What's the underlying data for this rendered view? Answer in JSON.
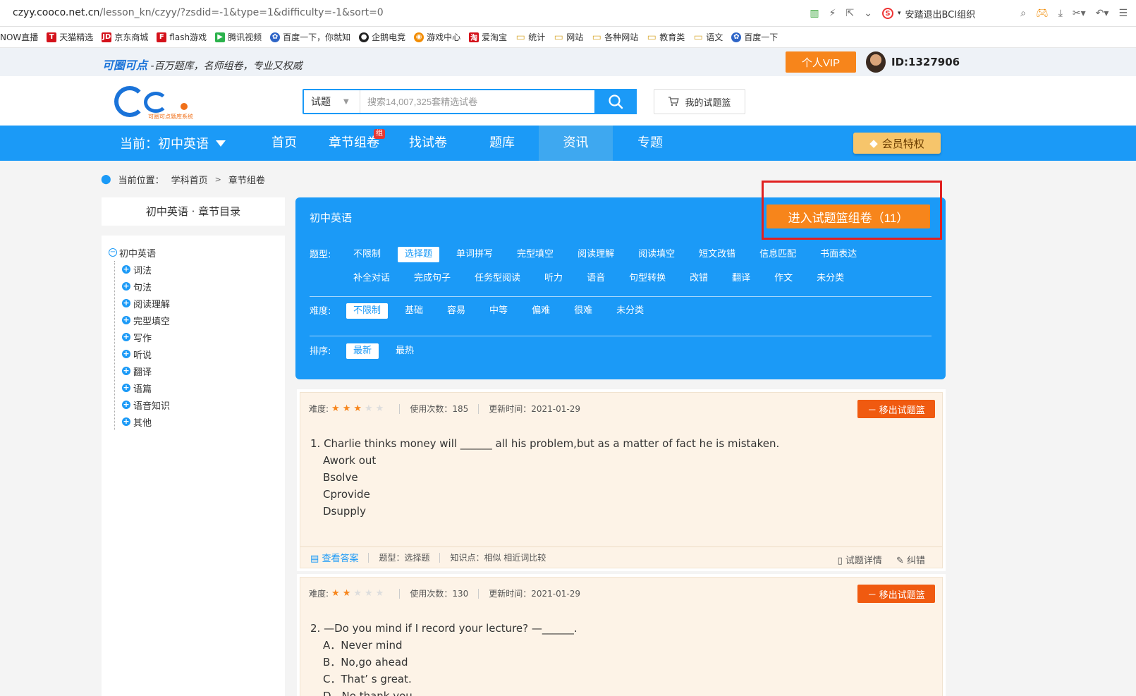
{
  "browser": {
    "url_host": "czyy.cooco.net.cn",
    "url_path": "/lesson_kn/czyy/?zsdid=-1&type=1&difficulty=-1&sort=0",
    "extension_label": "安踏退出BCI组织",
    "bookmarks": [
      {
        "label": "NOW直播",
        "icon": "none"
      },
      {
        "label": "天猫精选",
        "icon": "red",
        "glyph": "T"
      },
      {
        "label": "京东商城",
        "icon": "red",
        "glyph": "JD"
      },
      {
        "label": "flash游戏",
        "icon": "red",
        "glyph": "F"
      },
      {
        "label": "腾讯视频",
        "icon": "green",
        "glyph": "▶"
      },
      {
        "label": "百度一下，你就知",
        "icon": "blue",
        "glyph": "✿"
      },
      {
        "label": "企鹅电竞",
        "icon": "dark",
        "glyph": "●"
      },
      {
        "label": "游戏中心",
        "icon": "orange",
        "glyph": "◉"
      },
      {
        "label": "爱淘宝",
        "icon": "red",
        "glyph": "淘"
      },
      {
        "label": "统计",
        "icon": "folder",
        "glyph": "▭"
      },
      {
        "label": "网站",
        "icon": "folder",
        "glyph": "▭"
      },
      {
        "label": "各种网站",
        "icon": "folder",
        "glyph": "▭"
      },
      {
        "label": "教育类",
        "icon": "folder",
        "glyph": "▭"
      },
      {
        "label": "语文",
        "icon": "folder",
        "glyph": "▭"
      },
      {
        "label": "百度一下",
        "icon": "blue",
        "glyph": "✿"
      }
    ]
  },
  "topstrip": {
    "brand": "可圈可点",
    "slogan": "-百万题库，名师组卷，专业又权威",
    "vip_label": "个人VIP",
    "user_id": "ID:1327906"
  },
  "header": {
    "logo_sub": "可圈可点题库系统",
    "search_type": "试题",
    "search_placeholder": "搜索14,007,325套精选试卷",
    "basket_label": "我的试题篮"
  },
  "nav": {
    "current": "当前：初中英语",
    "items": [
      "首页",
      "章节组卷",
      "找试卷",
      "题库",
      "资讯",
      "专题"
    ],
    "badge": "组",
    "member_label": "会员特权"
  },
  "breadcrumb": {
    "prefix": "当前位置：",
    "items": [
      "学科首页",
      "章节组卷"
    ]
  },
  "sidebar": {
    "title": "初中英语 · 章节目录",
    "root": "初中英语",
    "children": [
      "词法",
      "句法",
      "阅读理解",
      "完型填空",
      "写作",
      "听说",
      "翻译",
      "语篇",
      "语音知识",
      "其他"
    ]
  },
  "filter": {
    "title": "初中英语",
    "enter_basket": "进入试题篮组卷（11）",
    "type_label": "题型:",
    "types": [
      "不限制",
      "选择题",
      "单词拼写",
      "完型填空",
      "阅读理解",
      "阅读填空",
      "短文改错",
      "信息匹配",
      "书面表达",
      "补全对话",
      "完成句子",
      "任务型阅读",
      "听力",
      "语音",
      "句型转换",
      "改错",
      "翻译",
      "作文",
      "未分类"
    ],
    "type_active": 1,
    "difficulty_label": "难度:",
    "difficulties": [
      "不限制",
      "基础",
      "容易",
      "中等",
      "偏难",
      "很难",
      "未分类"
    ],
    "difficulty_active": 0,
    "sort_label": "排序:",
    "sorts": [
      "最新",
      "最热"
    ],
    "sort_active": 0
  },
  "questions": [
    {
      "difficulty_label": "难度:",
      "stars": 3,
      "usage": "使用次数：185",
      "updated": "更新时间：2021-01-29",
      "remove_label": "－ 移出试题篮",
      "text": "1.  Charlie thinks money will ______ all his problem,but as a matter of fact he is mistaken.",
      "options": [
        "Awork out",
        "Bsolve",
        "Cprovide",
        "Dsupply"
      ],
      "answer_label": "查看答案",
      "qtype": "题型：选择题",
      "knowledge": "知识点：相似 相近词比较",
      "detail_label": "试题详情",
      "report_label": "纠错"
    },
    {
      "difficulty_label": "难度:",
      "stars": 2,
      "usage": "使用次数：130",
      "updated": "更新时间：2021-01-29",
      "remove_label": "－ 移出试题篮",
      "text": "2.  —Do you mind if I record your lecture?  —______.",
      "options": [
        "A．Never mind",
        "B．No,go ahead",
        "C．That’ s great.",
        "D．No,thank you"
      ]
    }
  ]
}
